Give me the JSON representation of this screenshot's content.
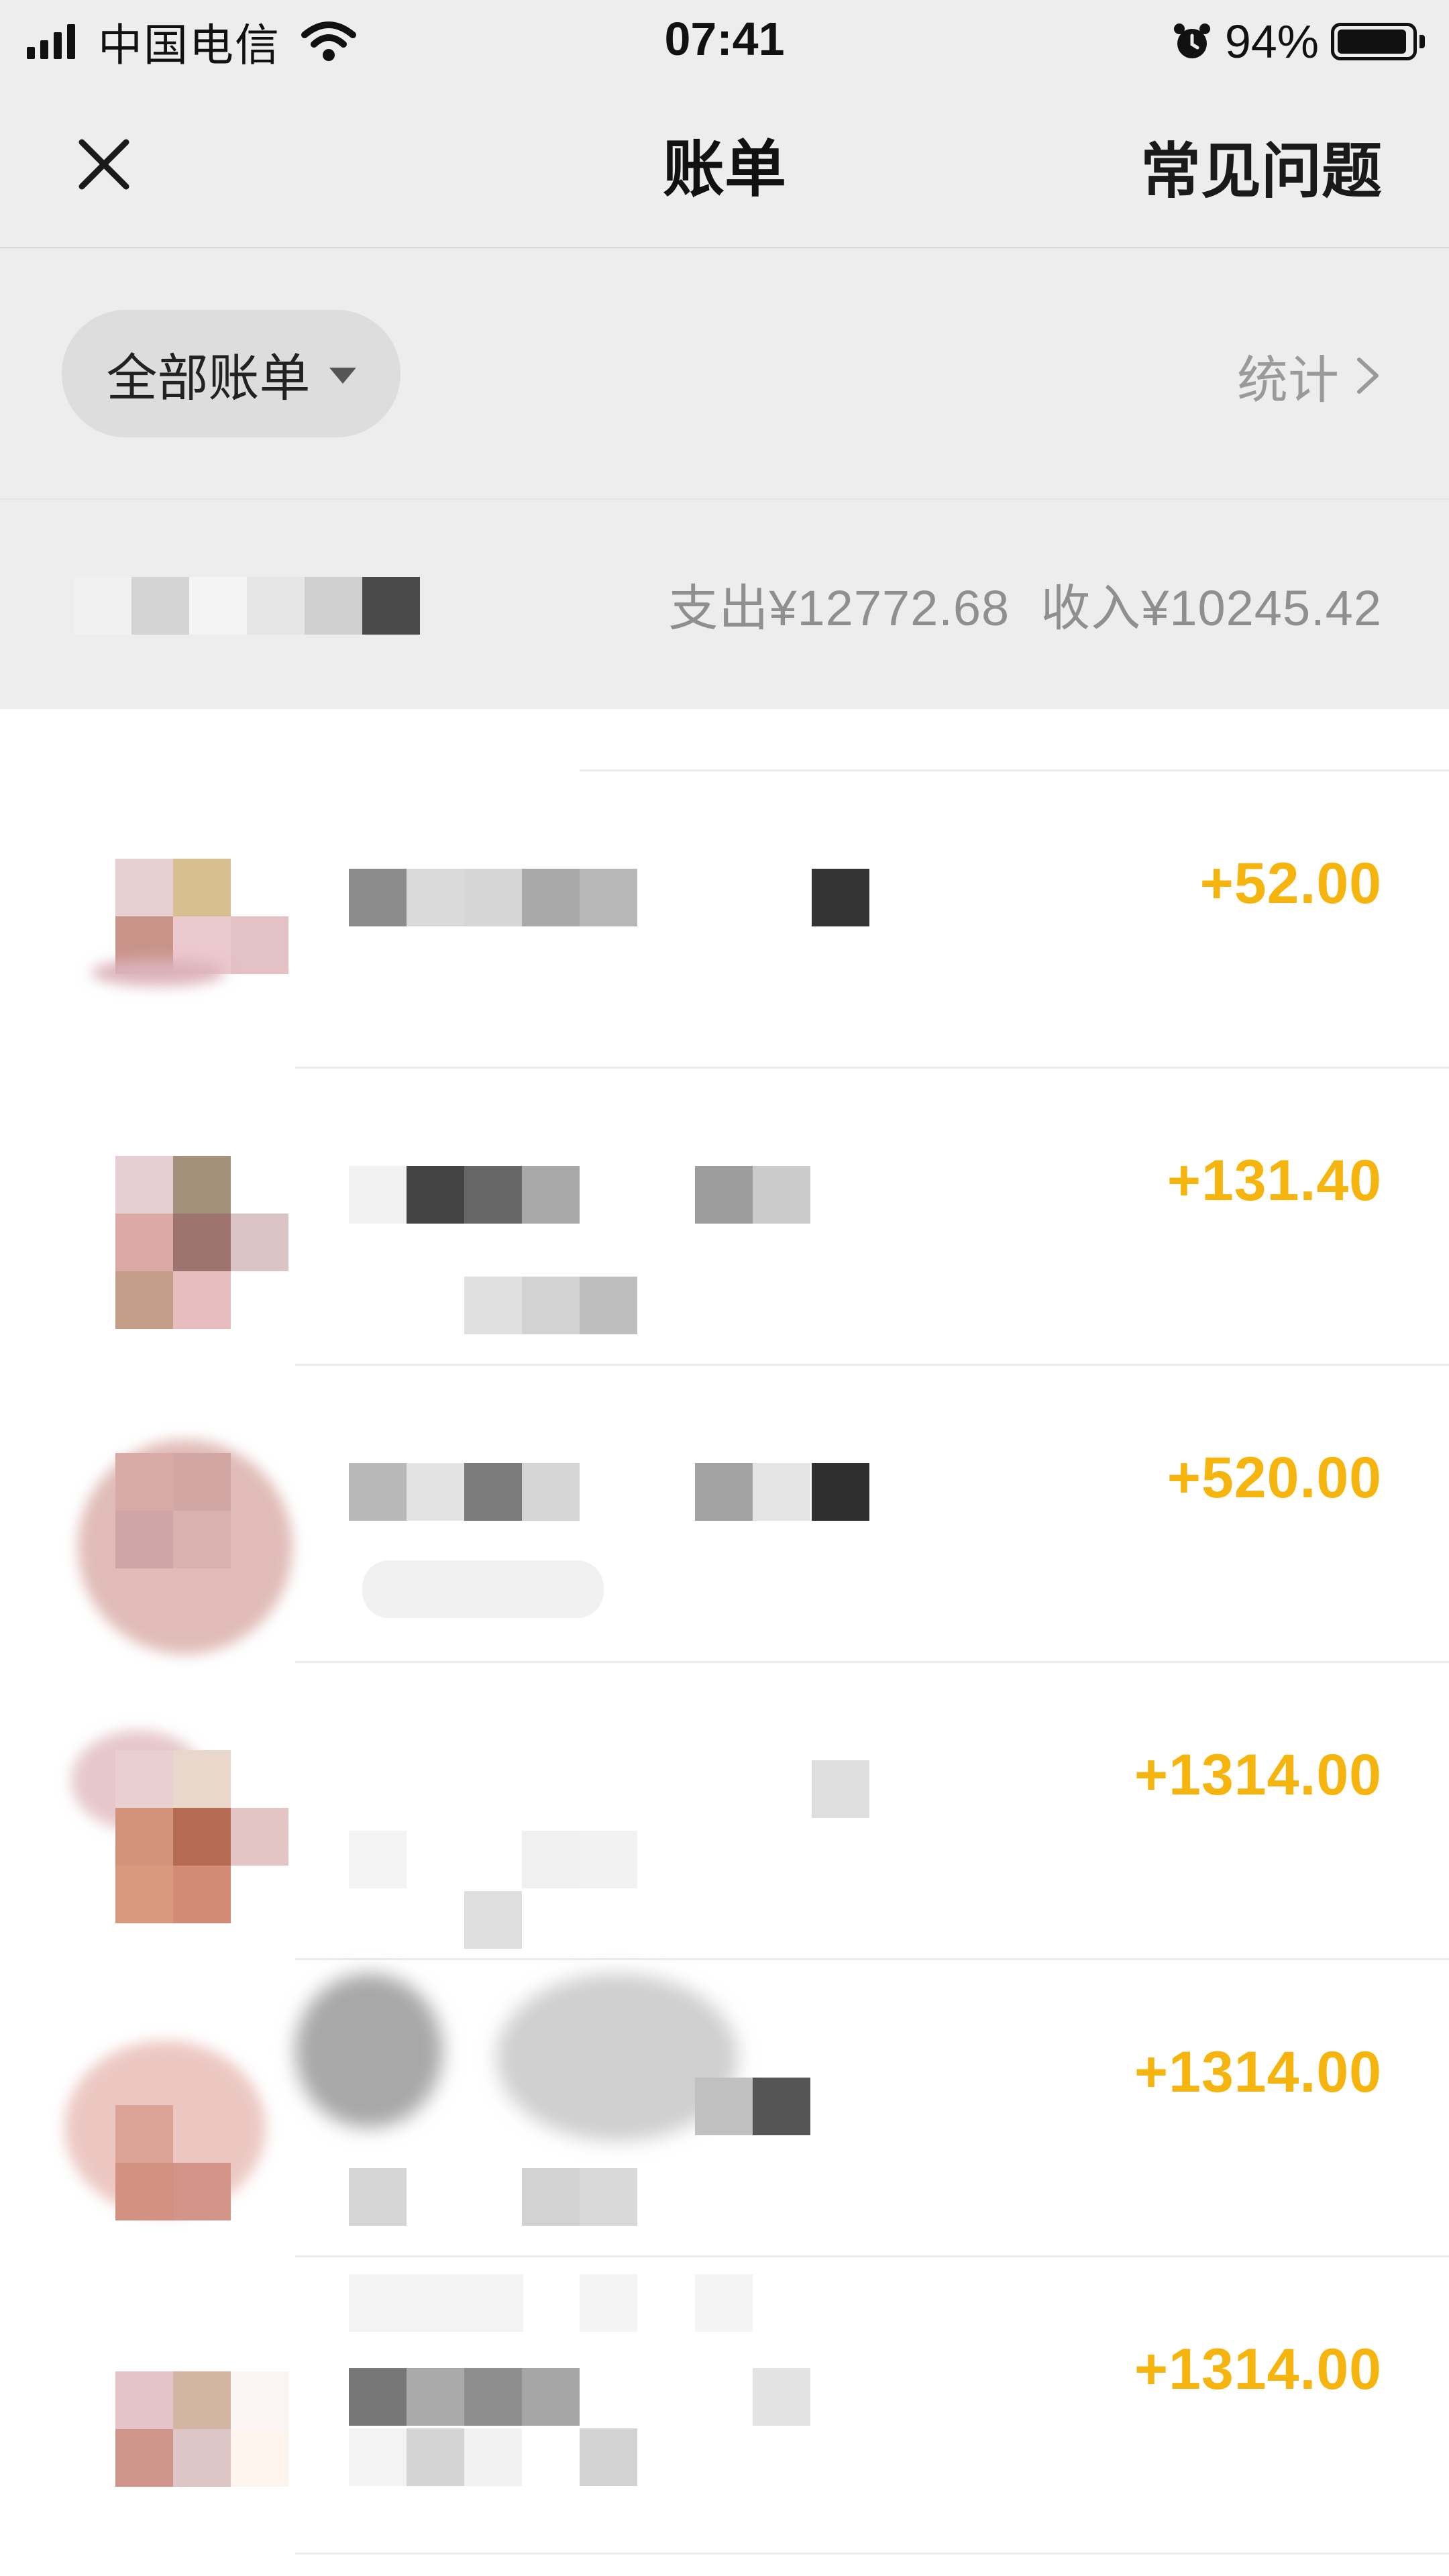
{
  "status_bar": {
    "carrier": "中国电信",
    "time": "07:41",
    "battery_percent": "94%",
    "battery_level": 0.94,
    "icons": [
      "signal-icon",
      "wifi-icon",
      "alarm-icon",
      "battery-icon"
    ]
  },
  "nav": {
    "title": "账单",
    "faq_label": "常见问题",
    "close_icon": "close-icon"
  },
  "filter": {
    "selected": "全部账单",
    "stats_label": "统计"
  },
  "summary": {
    "month_label": "",
    "expense": "支出¥12772.68",
    "income": "收入¥10245.42"
  },
  "transactions": [
    {
      "amount": "+52.00"
    },
    {
      "amount": "+131.40"
    },
    {
      "amount": "+520.00"
    },
    {
      "amount": "+1314.00"
    },
    {
      "amount": "+1314.00"
    },
    {
      "amount": "+1314.00"
    }
  ],
  "colors": {
    "accent_amount": "#f6b40e",
    "header_bg": "#ededed",
    "muted_text": "#8f8f8f"
  }
}
